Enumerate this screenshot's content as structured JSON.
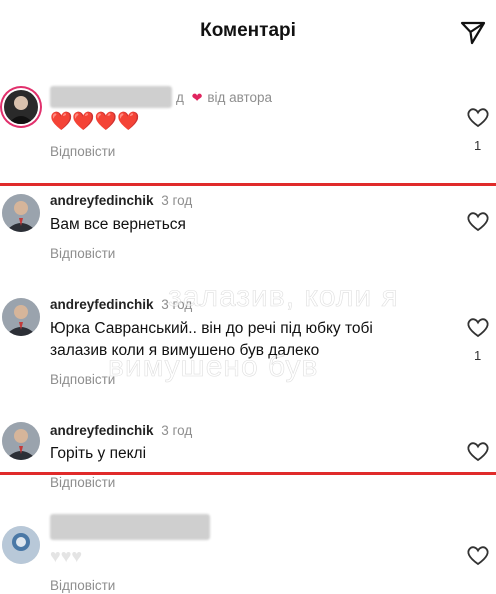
{
  "header": {
    "title": "Коментарі"
  },
  "comments": [
    {
      "username": "",
      "time": "д",
      "author_badge": "від автора",
      "text": "❤️❤️❤️❤️",
      "reply": "Відповісти",
      "likes": "1"
    },
    {
      "username": "andreyfedinchik",
      "time": "3 год",
      "text": "Вам все вернеться",
      "reply": "Відповісти",
      "likes": ""
    },
    {
      "username": "andreyfedinchik",
      "time": "3 год",
      "text_line1": "Юрка Савранський.. він до речі під юбку тобі",
      "text_line2": "залазив коли я вимушено був далеко",
      "reply": "Відповісти",
      "likes": "1"
    },
    {
      "username": "andreyfedinchik",
      "time": "3 год",
      "text": "Горіть у пеклі",
      "reply": "Відповісти",
      "likes": ""
    },
    {
      "username": "",
      "text": "",
      "reply": "Відповісти",
      "likes": ""
    }
  ],
  "overlay": {
    "line1": "залазив, коли я",
    "line2": "вимушено був"
  },
  "colors": {
    "highlight": "#e02a2a",
    "heart_red": "#e0245e",
    "muted": "#8e8e8e"
  }
}
